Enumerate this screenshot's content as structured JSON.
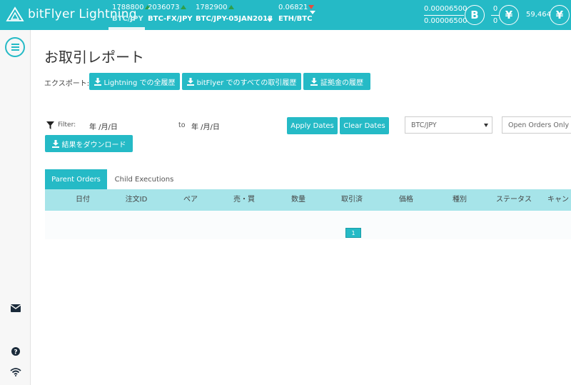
{
  "header": {
    "logo_text": "bitFlyer Lightning",
    "tickers": [
      {
        "price": "1788800",
        "trend": "up",
        "pair": "BTC/JPY",
        "active": true
      },
      {
        "price": "2036073",
        "trend": "up",
        "pair": "BTC-FX/JPY",
        "active": false
      },
      {
        "price": "1782900",
        "trend": "up",
        "pair": "BTC/JPY-05JAN2018",
        "active": false
      },
      {
        "price": "0.06821",
        "trend": "down",
        "pair": "ETH/BTC",
        "active": false
      }
    ],
    "btc_balance_top": "0.00006500",
    "btc_balance_bottom": "0.00006500",
    "jpy_balance_top": "0",
    "jpy_balance_bottom": "0",
    "collateral": "59,464",
    "coin_btc": "B",
    "coin_jpy": "¥",
    "coin_collateral": "¥",
    "colors": {
      "accent": "#25bac6",
      "header_bg": "#25bac6",
      "table_head": "#a6e4e9",
      "up": "#2e9e4a",
      "down": "#e84c3d"
    }
  },
  "sidebar": {
    "icons": [
      "menu-icon",
      "mail-icon",
      "help-icon",
      "wifi-icon"
    ]
  },
  "page": {
    "title": "お取引レポート",
    "export_label": "エクスポート:",
    "export_buttons": [
      "Lightning での全履歴",
      "bitFlyer でのすべての取引履歴",
      "証拠金の履歴"
    ],
    "filter_label": "Filter:",
    "date_from": "年 /月/日",
    "to_label": "to",
    "date_to": "年 /月/日",
    "apply_dates": "Apply Dates",
    "clear_dates": "Clear Dates",
    "pair_select": "BTC/JPY",
    "order_select": "Open Orders Only",
    "download_results": "結果をダウンロード",
    "tabs": [
      "Parent Orders",
      "Child Executions"
    ],
    "columns": [
      "日付",
      "注文ID",
      "ペア",
      "売・買",
      "数量",
      "取引済",
      "価格",
      "種別",
      "ステータス",
      "キャン"
    ],
    "page_number": "1"
  }
}
